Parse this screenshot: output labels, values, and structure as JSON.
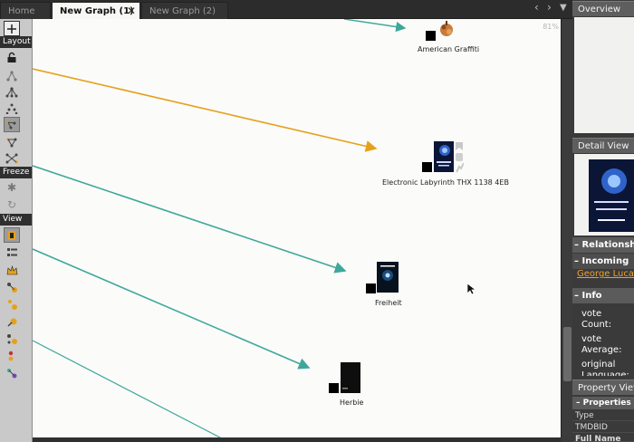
{
  "tabs": {
    "home": "Home",
    "graph1": "New Graph (1)",
    "graph2": "New Graph (2)",
    "close_glyph": "✕"
  },
  "toolbar": {
    "layout_label": "Layout",
    "freeze_label": "Freeze",
    "view_label": "View"
  },
  "canvas": {
    "zoom": "81%",
    "nodes": {
      "n1": "American Graffiti",
      "n2": "Electronic Labyrinth THX 1138 4EB",
      "n3": "Freiheit",
      "n4": "Herbie"
    }
  },
  "right_panel": {
    "overview_title": "Overview",
    "detail_title": "Detail View",
    "relationships_label": "– Relationships",
    "incoming_label": "– Incoming",
    "incoming_link": "George Lucas",
    "info_label": "– Info",
    "info_line1": "vote",
    "info_line2": "Count:",
    "info_line3": "vote",
    "info_line4": "Average:",
    "info_line5": "original",
    "info_line6": "Language:",
    "property_title": "Property View",
    "properties_label": "– Properties",
    "prop_type": "Type",
    "prop_tmdbid": "TMDBID",
    "prop_fullname": "Full Name"
  },
  "colors": {
    "accent_orange": "#e6a11c",
    "edge_teal": "#3ea79a",
    "link_orange": "#f0a12a"
  }
}
